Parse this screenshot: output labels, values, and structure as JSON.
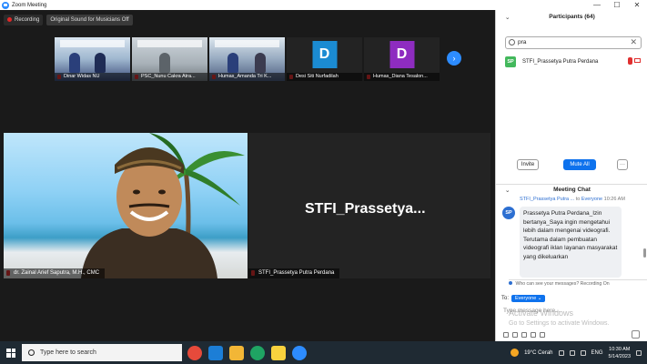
{
  "window": {
    "title": "Zoom Meeting",
    "controls": [
      "—",
      "☐",
      "✕"
    ]
  },
  "meeting": {
    "recording_label": "Recording",
    "original_sound_label": "Original Sound for Musicians Off",
    "thumbnails": [
      {
        "name": "Dinar Widas NU",
        "type": "video"
      },
      {
        "name": "PSC_Nunu Cakra Atra...",
        "type": "video"
      },
      {
        "name": "Humas_Amanda Tri K...",
        "type": "video"
      },
      {
        "name": "Desi Siti Nurfadilah",
        "type": "initial",
        "initial": "D",
        "color": "#1b8bd2"
      },
      {
        "name": "Humas_Diana Tesalon...",
        "type": "initial",
        "initial": "D",
        "color": "#8e2cc0"
      }
    ],
    "strip_next": "›",
    "main_video_label": "dr. Zainal Arief Saputra, M.H., CMC",
    "speaker_tile_label": "STFI_Prassetya Putra Perdana",
    "speaker_display_name": "STFI_Prassetya..."
  },
  "participants": {
    "header": "Participants (64)",
    "search_value": "pra",
    "clear_icon": "✕",
    "rows": [
      {
        "initials": "SP",
        "name": "STFI_Prassetya Putra Perdana"
      }
    ],
    "buttons": {
      "invite": "Invite",
      "mute_all": "Mute All",
      "more": "···"
    }
  },
  "chat": {
    "header": "Meeting Chat",
    "sender": "STFI_Prassetya Putra ...",
    "to_word": "to",
    "recipient": "Everyone",
    "time": "10:26 AM",
    "sender_initials": "SP",
    "message": "Prassetya Putra Perdana_Izin bertanya_Saya ingin mengetahui lebih dalam mengenai videografi. Terutama dalam pembuatan videografi iklan layanan masyarakat yang dikeluarkan",
    "privacy_notice": "Who can see your messages? Recording On",
    "to_label": "To:",
    "to_select": "Everyone ⌄",
    "input_placeholder": "Type message here...",
    "activate_title": "Activate Windows",
    "activate_sub": "Go to Settings to activate Windows."
  },
  "taskbar": {
    "search_placeholder": "Type here to search",
    "apps": [
      {
        "name": "chrome",
        "color": "#e64a3b"
      },
      {
        "name": "mail",
        "color": "#1c7ed6"
      },
      {
        "name": "explorer",
        "color": "#f2b636"
      },
      {
        "name": "edge",
        "color": "#1fa463"
      },
      {
        "name": "sticky",
        "color": "#f7d23e"
      },
      {
        "name": "zoom",
        "color": "#2d8cff"
      }
    ],
    "weather": "19°C Cerah",
    "language": "ENG",
    "time": "10:30 AM",
    "date": "5/14/2023"
  }
}
